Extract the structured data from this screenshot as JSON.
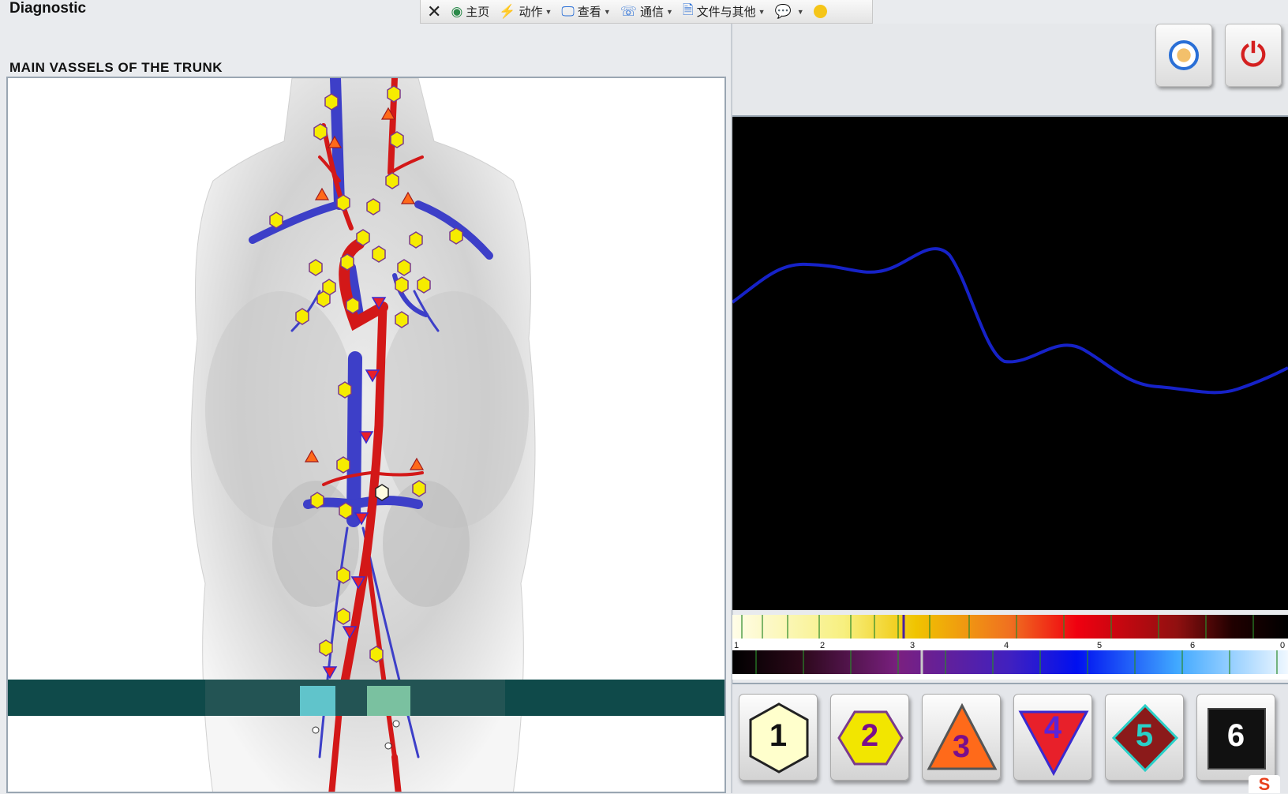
{
  "app": {
    "title": "Diagnostic"
  },
  "toolbar": {
    "items": [
      {
        "label": "主页",
        "icon": "home-icon"
      },
      {
        "label": "动作",
        "icon": "lightning-icon"
      },
      {
        "label": "查看",
        "icon": "monitor-icon"
      },
      {
        "label": "通信",
        "icon": "phone-icon"
      },
      {
        "label": "文件与其他",
        "icon": "file-transfer-icon"
      }
    ],
    "close_icon": "close-icon",
    "chat_icon": "chat-icon",
    "emoji_icon": "emoji-icon"
  },
  "section": {
    "title": "MAIN VASSELS OF THE TRUNK"
  },
  "controls": {
    "sound_icon": "speaker-icon",
    "power_icon": "power-icon",
    "accent_power": "#d42020",
    "accent_sound": "#2a6fd6"
  },
  "scope": {
    "background": "#000000",
    "trace_color": "#1622c8"
  },
  "spectrum": {
    "scale_labels": [
      "1",
      "2",
      "3",
      "4",
      "5",
      "6",
      "0"
    ]
  },
  "levels": [
    {
      "label": "1",
      "shape": "hexagon",
      "fill": "#ffffcc",
      "text_color": "#111111"
    },
    {
      "label": "2",
      "shape": "hexagon",
      "fill": "#f2e600",
      "text_color": "#7a0e8c"
    },
    {
      "label": "3",
      "shape": "triangle-up",
      "fill": "#ff6a1a",
      "text_color": "#7a0e8c"
    },
    {
      "label": "4",
      "shape": "triangle-down",
      "fill": "#e8202a",
      "text_color": "#5a24d8"
    },
    {
      "label": "5",
      "shape": "diamond",
      "fill": "#8b1a1a",
      "text_color": "#2ad0c8"
    },
    {
      "label": "6",
      "shape": "square",
      "fill": "#111111",
      "text_color": "#ffffff"
    }
  ],
  "tray": {
    "icon": "sogou-icon",
    "label": "S"
  }
}
